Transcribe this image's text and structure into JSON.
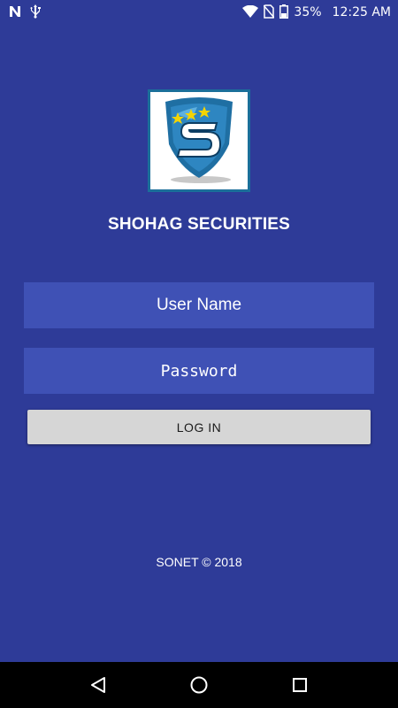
{
  "status_bar": {
    "battery": "35%",
    "time": "12:25 AM",
    "icons": [
      "n-notification-icon",
      "usb-icon",
      "wifi-icon",
      "no-sim-icon",
      "battery-icon"
    ]
  },
  "app": {
    "logo_icon": "shield-logo-icon",
    "title": "SHOHAG SECURITIES",
    "username_placeholder": "User Name",
    "password_placeholder": "Password",
    "login_label": "LOG IN",
    "footer": "SONET © 2018"
  },
  "colors": {
    "background": "#2e3b98",
    "field": "#3f51b5",
    "button": "#d6d6d6",
    "nav_bar": "#000000"
  },
  "nav_bar": {
    "icons": [
      "back-icon",
      "home-icon",
      "recents-icon"
    ]
  }
}
